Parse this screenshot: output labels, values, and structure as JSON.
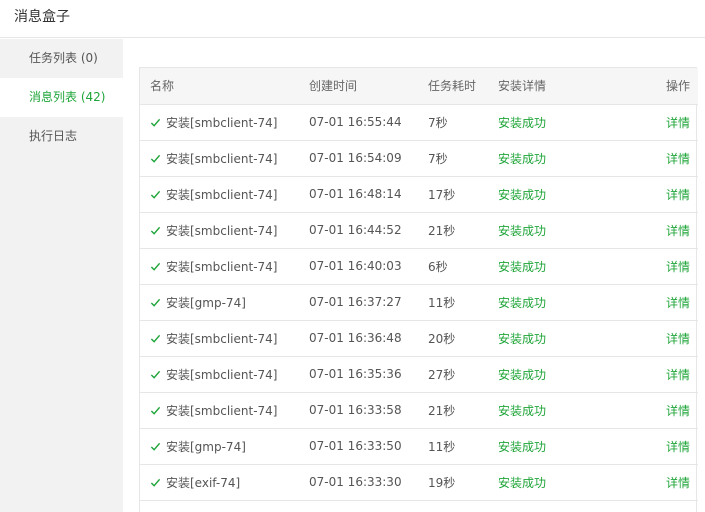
{
  "window": {
    "title": "消息盒子"
  },
  "sidebar": {
    "items": [
      {
        "label": "任务列表 (0)",
        "active": false
      },
      {
        "label": "消息列表 (42)",
        "active": true
      },
      {
        "label": "执行日志",
        "active": false
      }
    ]
  },
  "table": {
    "columns": {
      "name": "名称",
      "created": "创建时间",
      "duration": "任务耗时",
      "detail": "安装详情",
      "action": "操作"
    },
    "rows": [
      {
        "name": "安装[smbclient-74]",
        "created": "07-01 16:55:44",
        "duration": "7秒",
        "status": "安装成功",
        "action": "详情"
      },
      {
        "name": "安装[smbclient-74]",
        "created": "07-01 16:54:09",
        "duration": "7秒",
        "status": "安装成功",
        "action": "详情"
      },
      {
        "name": "安装[smbclient-74]",
        "created": "07-01 16:48:14",
        "duration": "17秒",
        "status": "安装成功",
        "action": "详情"
      },
      {
        "name": "安装[smbclient-74]",
        "created": "07-01 16:44:52",
        "duration": "21秒",
        "status": "安装成功",
        "action": "详情"
      },
      {
        "name": "安装[smbclient-74]",
        "created": "07-01 16:40:03",
        "duration": "6秒",
        "status": "安装成功",
        "action": "详情"
      },
      {
        "name": "安装[gmp-74]",
        "created": "07-01 16:37:27",
        "duration": "11秒",
        "status": "安装成功",
        "action": "详情"
      },
      {
        "name": "安装[smbclient-74]",
        "created": "07-01 16:36:48",
        "duration": "20秒",
        "status": "安装成功",
        "action": "详情"
      },
      {
        "name": "安装[smbclient-74]",
        "created": "07-01 16:35:36",
        "duration": "27秒",
        "status": "安装成功",
        "action": "详情"
      },
      {
        "name": "安装[smbclient-74]",
        "created": "07-01 16:33:58",
        "duration": "21秒",
        "status": "安装成功",
        "action": "详情"
      },
      {
        "name": "安装[gmp-74]",
        "created": "07-01 16:33:50",
        "duration": "11秒",
        "status": "安装成功",
        "action": "详情"
      },
      {
        "name": "安装[exif-74]",
        "created": "07-01 16:33:30",
        "duration": "19秒",
        "status": "安装成功",
        "action": "详情"
      }
    ]
  },
  "colors": {
    "accent": "#20a53a",
    "sidebar_bg": "#f2f2f2",
    "border": "#e6e6e6"
  },
  "icons": {
    "row_status": "check-icon"
  }
}
